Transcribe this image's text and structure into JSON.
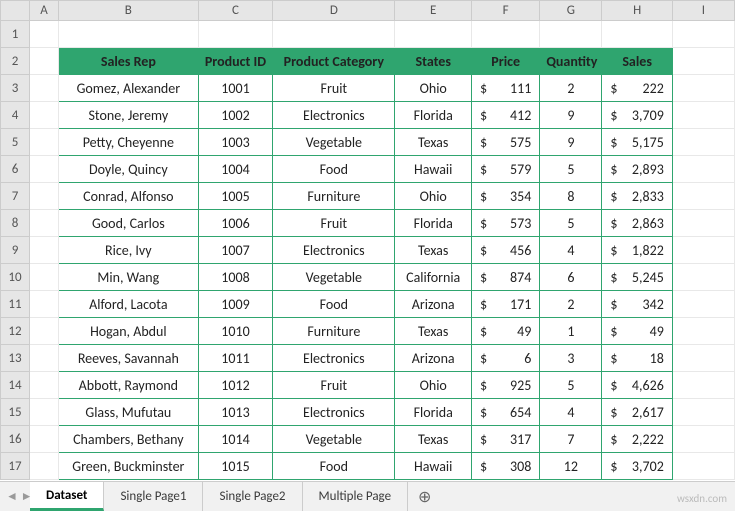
{
  "columns": [
    "A",
    "B",
    "C",
    "D",
    "E",
    "F",
    "G",
    "H",
    "I"
  ],
  "row_numbers": [
    1,
    2,
    3,
    4,
    5,
    6,
    7,
    8,
    9,
    10,
    11,
    12,
    13,
    14,
    15,
    16,
    17
  ],
  "header": {
    "sales_rep": "Sales Rep",
    "product_id": "Product ID",
    "product_category": "Product Category",
    "states": "States",
    "price": "Price",
    "quantity": "Quantity",
    "sales": "Sales"
  },
  "rows": [
    {
      "rep": "Gomez, Alexander",
      "pid": "1001",
      "cat": "Fruit",
      "state": "Ohio",
      "price": "111",
      "qty": "2",
      "sales": "222"
    },
    {
      "rep": "Stone, Jeremy",
      "pid": "1002",
      "cat": "Electronics",
      "state": "Florida",
      "price": "412",
      "qty": "9",
      "sales": "3,709"
    },
    {
      "rep": "Petty, Cheyenne",
      "pid": "1003",
      "cat": "Vegetable",
      "state": "Texas",
      "price": "575",
      "qty": "9",
      "sales": "5,175"
    },
    {
      "rep": "Doyle, Quincy",
      "pid": "1004",
      "cat": "Food",
      "state": "Hawaii",
      "price": "579",
      "qty": "5",
      "sales": "2,893"
    },
    {
      "rep": "Conrad, Alfonso",
      "pid": "1005",
      "cat": "Furniture",
      "state": "Ohio",
      "price": "354",
      "qty": "8",
      "sales": "2,833"
    },
    {
      "rep": "Good, Carlos",
      "pid": "1006",
      "cat": "Fruit",
      "state": "Florida",
      "price": "573",
      "qty": "5",
      "sales": "2,863"
    },
    {
      "rep": "Rice, Ivy",
      "pid": "1007",
      "cat": "Electronics",
      "state": "Texas",
      "price": "456",
      "qty": "4",
      "sales": "1,822"
    },
    {
      "rep": "Min, Wang",
      "pid": "1008",
      "cat": "Vegetable",
      "state": "California",
      "price": "874",
      "qty": "6",
      "sales": "5,245"
    },
    {
      "rep": "Alford, Lacota",
      "pid": "1009",
      "cat": "Food",
      "state": "Arizona",
      "price": "171",
      "qty": "2",
      "sales": "342"
    },
    {
      "rep": "Hogan, Abdul",
      "pid": "1010",
      "cat": "Furniture",
      "state": "Texas",
      "price": "49",
      "qty": "1",
      "sales": "49"
    },
    {
      "rep": "Reeves, Savannah",
      "pid": "1011",
      "cat": "Electronics",
      "state": "Arizona",
      "price": "6",
      "qty": "3",
      "sales": "18"
    },
    {
      "rep": "Abbott, Raymond",
      "pid": "1012",
      "cat": "Fruit",
      "state": "Ohio",
      "price": "925",
      "qty": "5",
      "sales": "4,626"
    },
    {
      "rep": "Glass, Mufutau",
      "pid": "1013",
      "cat": "Electronics",
      "state": "Florida",
      "price": "654",
      "qty": "4",
      "sales": "2,617"
    },
    {
      "rep": "Chambers, Bethany",
      "pid": "1014",
      "cat": "Vegetable",
      "state": "Texas",
      "price": "317",
      "qty": "7",
      "sales": "2,222"
    },
    {
      "rep": "Green, Buckminster",
      "pid": "1015",
      "cat": "Food",
      "state": "Hawaii",
      "price": "308",
      "qty": "12",
      "sales": "3,702"
    }
  ],
  "currency": "$",
  "tabs": {
    "items": [
      "Dataset",
      "Single Page1",
      "Single Page2",
      "Multiple Page"
    ],
    "active": 0,
    "add_label": "+"
  },
  "watermark": "wsxdn.com"
}
